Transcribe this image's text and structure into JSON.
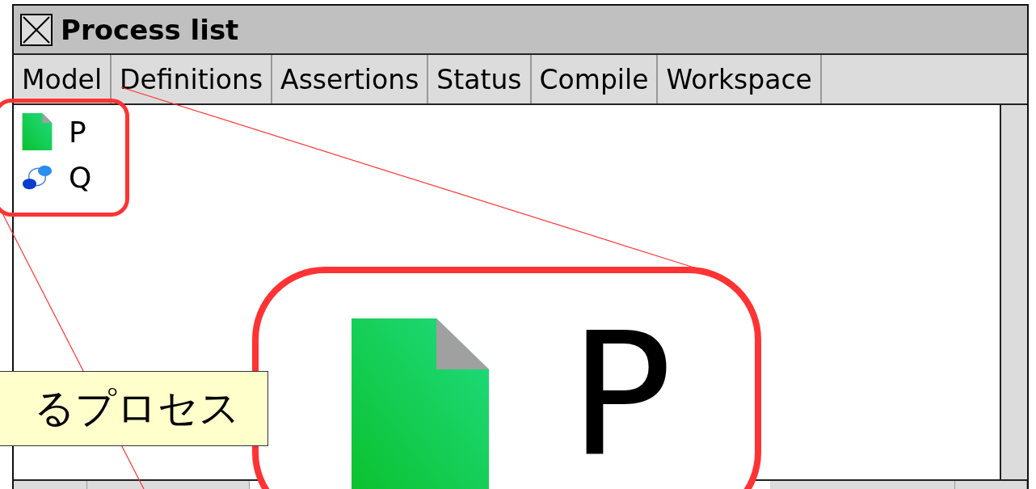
{
  "window": {
    "title": "Process list"
  },
  "tabs": [
    {
      "label": "Model"
    },
    {
      "label": "Definitions"
    },
    {
      "label": "Assertions"
    },
    {
      "label": "Status"
    },
    {
      "label": "Compile"
    },
    {
      "label": "Workspace"
    }
  ],
  "processes": [
    {
      "name": "P",
      "kind": "file"
    },
    {
      "name": "Q",
      "kind": "link"
    }
  ],
  "callout": {
    "label": "るプロセス"
  },
  "magnified": {
    "name": "P",
    "kind": "file"
  }
}
